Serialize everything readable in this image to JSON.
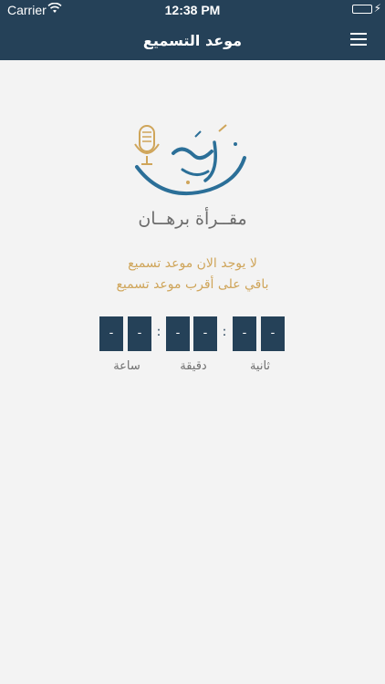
{
  "status_bar": {
    "carrier": "Carrier",
    "time": "12:38 PM",
    "battery_level": 1.0
  },
  "nav": {
    "title": "موعد التسميع",
    "menu_icon": "hamburger-menu-icon"
  },
  "logo": {
    "icon": "microphone-calligraphy-logo",
    "brand_text": "مقــرأة برهــان"
  },
  "messages": {
    "line1": "لا يوجد الان موعد تسميع",
    "line2": "باقي على أقرب موعد تسميع"
  },
  "countdown": {
    "hours_digits": [
      "-",
      "-"
    ],
    "minutes_digits": [
      "-",
      "-"
    ],
    "seconds_digits": [
      "-",
      "-"
    ],
    "separator": ":",
    "labels": {
      "hours": "ساعة",
      "minutes": "دقيقة",
      "seconds": "ثانية"
    }
  },
  "colors": {
    "primary": "#254158",
    "accent_gold": "#cfa55a",
    "logo_blue": "#2b6f98",
    "background": "#f3f3f3"
  }
}
